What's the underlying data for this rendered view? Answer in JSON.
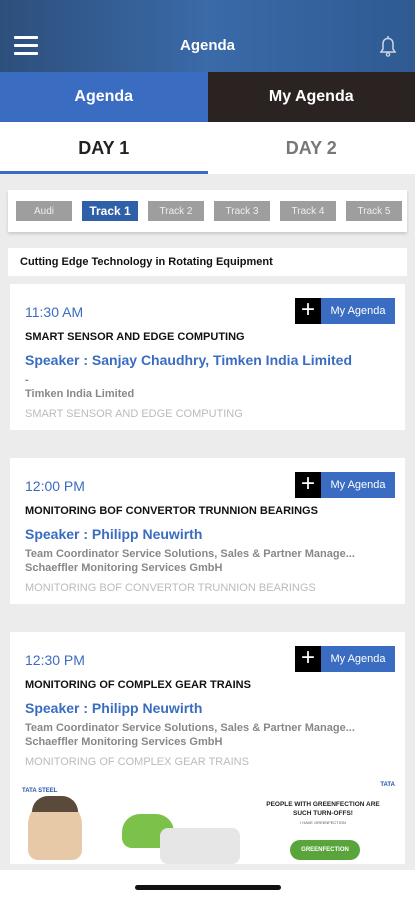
{
  "header": {
    "title": "Agenda",
    "menu_icon": "hamburger-icon",
    "bell_icon": "bell-icon"
  },
  "tabs": {
    "agenda": "Agenda",
    "my_agenda": "My Agenda"
  },
  "days": {
    "day1": "DAY 1",
    "day2": "DAY 2"
  },
  "tracks": [
    "Audi",
    "Track 1",
    "Track 2",
    "Track 3",
    "Track 4",
    "Track 5"
  ],
  "selected_track": "Track 1",
  "topic": "Cutting Edge Technology in Rotating Equipment",
  "sessions": [
    {
      "time": "11:30 AM",
      "button": "My Agenda",
      "title": "SMART SENSOR AND EDGE COMPUTING",
      "speaker": "Speaker : Sanjay Chaudhry, Timken India Limited",
      "line1": "-",
      "line2": "Timken India Limited",
      "line3": "SMART SENSOR AND EDGE COMPUTING"
    },
    {
      "time": "12:00 PM",
      "button": "My Agenda",
      "title": "MONITORING BOF CONVERTOR TRUNNION BEARINGS",
      "speaker": "Speaker : Philipp  Neuwirth",
      "line1": "Team Coordinator Service Solutions, Sales & Partner Manage...",
      "line2": "Schaeffler Monitoring Services GmbH",
      "line3": "MONITORING BOF CONVERTOR TRUNNION BEARINGS"
    },
    {
      "time": "12:30 PM",
      "button": "My Agenda",
      "title": "MONITORING OF COMPLEX GEAR TRAINS",
      "speaker": "Speaker : Philipp  Neuwirth",
      "line1": "Team Coordinator Service Solutions, Sales & Partner Manage...",
      "line2": "Schaeffler Monitoring Services GmbH",
      "line3": "MONITORING OF COMPLEX GEAR TRAINS"
    }
  ],
  "banner": {
    "brand_left": "TATA STEEL",
    "brand_right": "TATA",
    "headline": "PEOPLE WITH GREENFECTION ARE SUCH TURN-OFFS!",
    "small": "I HAVE GREENFECTION",
    "badge": "GREENFECTION"
  },
  "colors": {
    "primary": "#3a6cc2",
    "dark": "#2b2321",
    "background": "#ececec"
  }
}
